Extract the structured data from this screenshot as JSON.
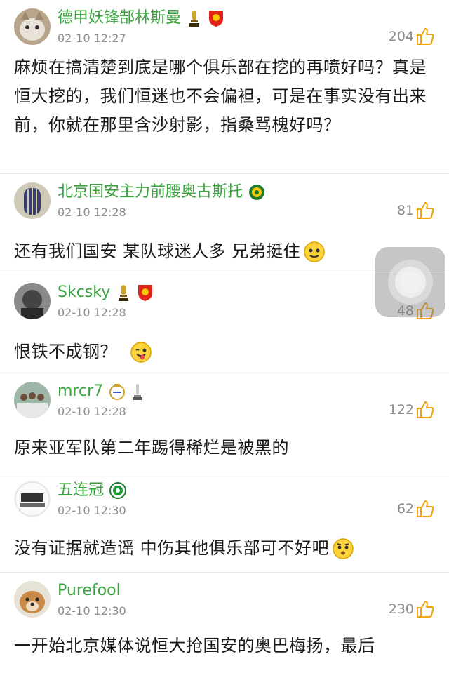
{
  "comments": [
    {
      "user": "德甲妖锋郜林斯曼",
      "time": "02-10 12:27",
      "likes": "204",
      "text": "麻烦在搞清楚到底是哪个俱乐部在挖的再喷好吗？真是恒大挖的，我们恒迷也不会偏袒，可是在事实没有出来前，你就在那里含沙射影，指桑骂槐好吗？"
    },
    {
      "user": "北京国安主力前腰奥古斯托",
      "time": "02-10 12:28",
      "likes": "81",
      "text": "还有我们国安 某队球迷人多 兄弟挺住"
    },
    {
      "user": "Skcsky",
      "time": "02-10 12:28",
      "likes": "48",
      "text": "恨铁不成钢？"
    },
    {
      "user": "mrcr7",
      "time": "02-10 12:28",
      "likes": "122",
      "text": "原来亚军队第二年踢得稀烂是被黑的"
    },
    {
      "user": "五连冠",
      "time": "02-10 12:30",
      "likes": "62",
      "text": "没有证据就造谣 中伤其他俱乐部可不好吧"
    },
    {
      "user": "Purefool",
      "time": "02-10 12:30",
      "likes": "230",
      "text": "一开始北京媒体说恒大抢国安的奥巴梅扬，最后"
    }
  ],
  "icons": {
    "thumb": "thumbs-up-icon",
    "trophy": "trophy-icon",
    "crest": "club-crest-icon",
    "emoji_smile": "smile-emoji",
    "emoji_tongue": "tongue-emoji",
    "emoji_worried": "worried-emoji"
  },
  "colors": {
    "username": "#3aa23f",
    "meta": "#8c8c8c",
    "accent": "#f0a30a"
  }
}
